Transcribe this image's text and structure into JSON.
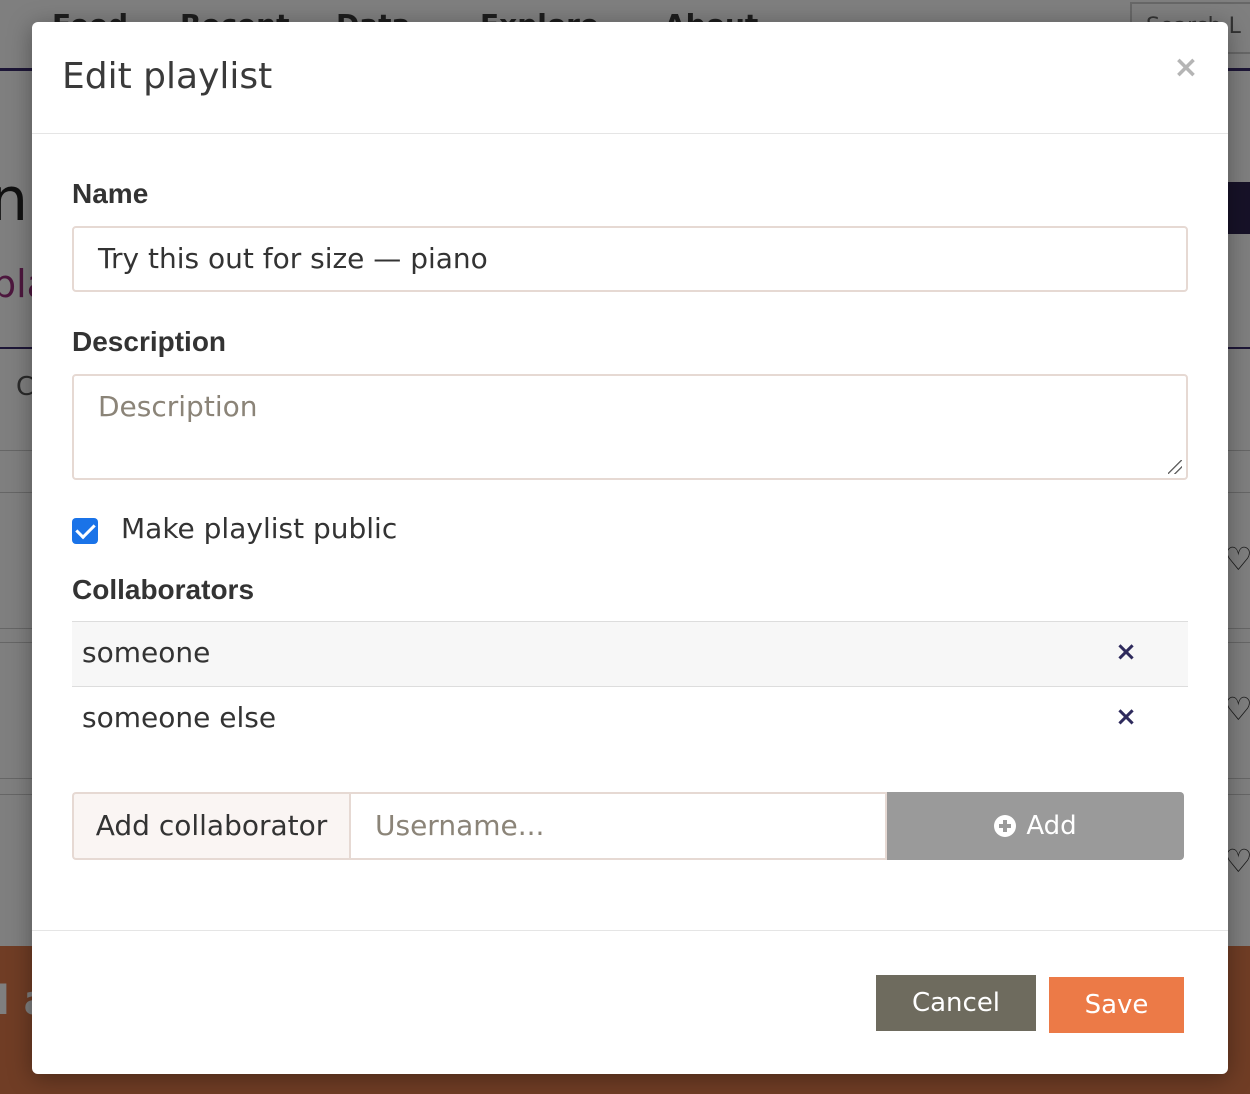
{
  "background": {
    "nav_items": [
      "Feed",
      "Recent",
      "Data",
      "Explore",
      "About"
    ],
    "search_placeholder": "Search L"
  },
  "modal": {
    "title": "Edit playlist",
    "close_symbol": "×",
    "name_label": "Name",
    "name_value": "Try this out for size — piano",
    "description_label": "Description",
    "description_placeholder": "Description",
    "public_checked": true,
    "public_label": "Make playlist public",
    "collaborators_label": "Collaborators",
    "collaborators": [
      {
        "name": "someone",
        "remove_symbol": "×"
      },
      {
        "name": "someone else",
        "remove_symbol": "×"
      }
    ],
    "add_collaborator_label": "Add collaborator",
    "username_placeholder": "Username...",
    "add_button_label": "Add",
    "cancel_label": "Cancel",
    "save_label": "Save"
  },
  "colors": {
    "primary_nav": "#3b2d6e",
    "save": "#ec7a47",
    "cancel": "#6e6b5e",
    "add_button": "#9a9a9a",
    "checkbox": "#1a73e8"
  }
}
